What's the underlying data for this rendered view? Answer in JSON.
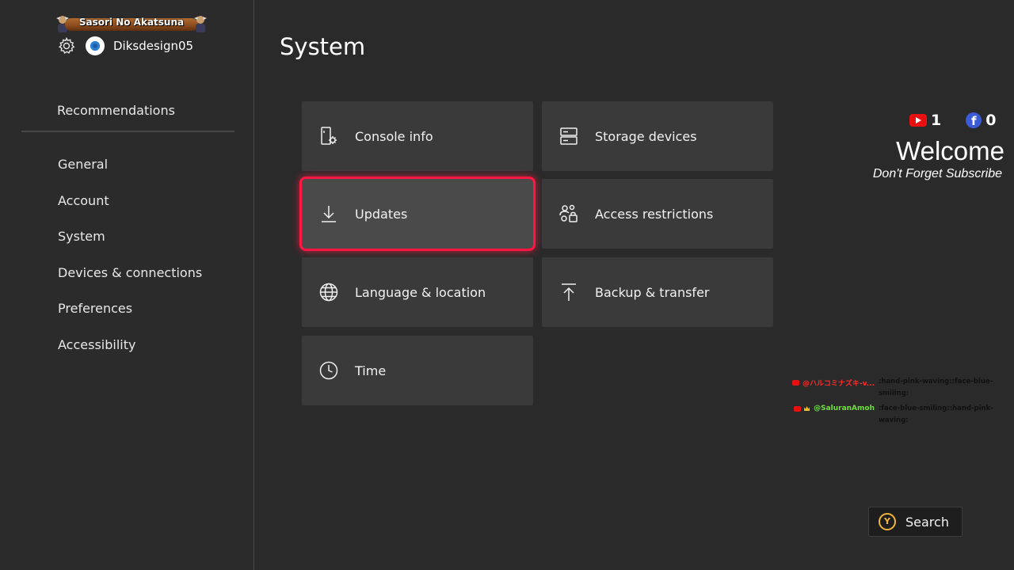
{
  "sidebar": {
    "banner": "Sasori No Akatsuna",
    "gamertag": "Diksdesign05",
    "recommendations": "Recommendations",
    "nav": [
      "General",
      "Account",
      "System",
      "Devices & connections",
      "Preferences",
      "Accessibility"
    ]
  },
  "main": {
    "title": "System",
    "tiles": [
      {
        "label": "Console info",
        "icon": "console-info-icon"
      },
      {
        "label": "Storage devices",
        "icon": "storage-devices-icon"
      },
      {
        "label": "Updates",
        "icon": "download-icon",
        "focused": true
      },
      {
        "label": "Access restrictions",
        "icon": "access-restrictions-icon"
      },
      {
        "label": "Language & location",
        "icon": "globe-icon"
      },
      {
        "label": "Backup & transfer",
        "icon": "upload-icon"
      },
      {
        "label": "Time",
        "icon": "clock-icon"
      }
    ]
  },
  "overlay": {
    "youtube_count": "1",
    "facebook_count": "0",
    "welcome": "Welcome",
    "subscribe": "Don't Forget Subscribe",
    "chat": [
      {
        "user": "@ハルコミナズキ-v...",
        "message": ":hand-pink-waving::face-blue-smiling:"
      },
      {
        "user": "@SaluranAmoh",
        "message": ":face-blue-smiling::hand-pink-waving:"
      }
    ]
  },
  "search": {
    "button_glyph": "Y",
    "label": "Search"
  },
  "colors": {
    "background": "#2a2a2a",
    "tile": "#3a3a3a",
    "focus": "#ff1744",
    "youtube": "#e81010",
    "facebook": "#3b5bd6",
    "y_button": "#f0b43a"
  }
}
